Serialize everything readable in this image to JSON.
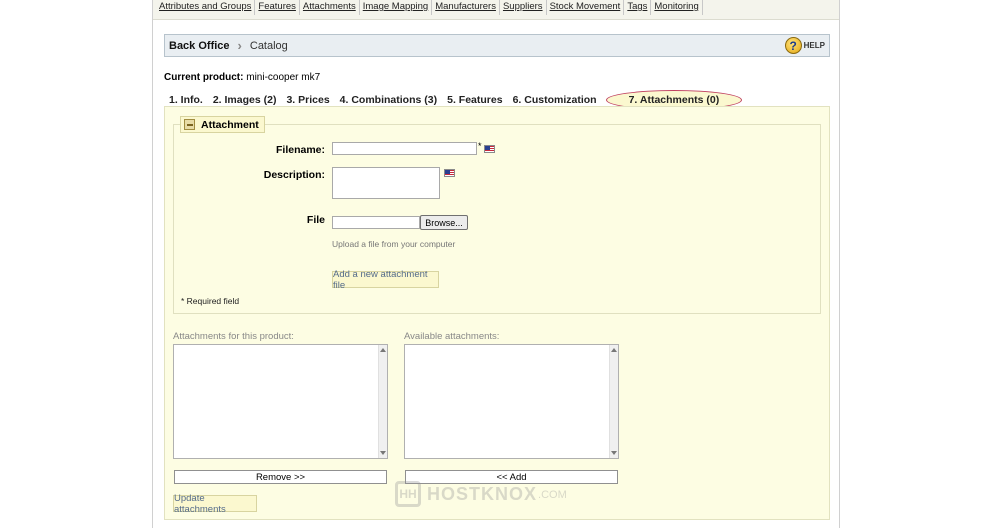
{
  "topnav": [
    "Attributes and Groups",
    "Features",
    "Attachments",
    "Image Mapping",
    "Manufacturers",
    "Suppliers",
    "Stock Movement",
    "Tags",
    "Monitoring"
  ],
  "breadcrumb": {
    "home": "Back Office",
    "current": "Catalog",
    "help": "HELP"
  },
  "product": {
    "label": "Current product:",
    "name": "mini-cooper mk7"
  },
  "tabs": [
    "1. Info.",
    "2. Images (2)",
    "3. Prices",
    "4. Combinations (3)",
    "5. Features",
    "6. Customization"
  ],
  "active_tab": "7. Attachments (0)",
  "form": {
    "legend": "Attachment",
    "filename_label": "Filename:",
    "filename_value": "",
    "description_label": "Description:",
    "description_value": "",
    "file_label": "File",
    "browse_label": "Browse...",
    "upload_hint": "Upload a file from your computer",
    "add_button": "Add a new attachment file",
    "required_mark": "*",
    "required_note": "* Required field"
  },
  "lists": {
    "product_label": "Attachments for this product:",
    "available_label": "Available attachments:",
    "remove_button": "Remove >>",
    "add_button": "<< Add",
    "update_button": "Update attachments"
  },
  "watermark": {
    "logo": "HH",
    "name": "HOSTKNOX",
    "suffix": ".COM"
  }
}
